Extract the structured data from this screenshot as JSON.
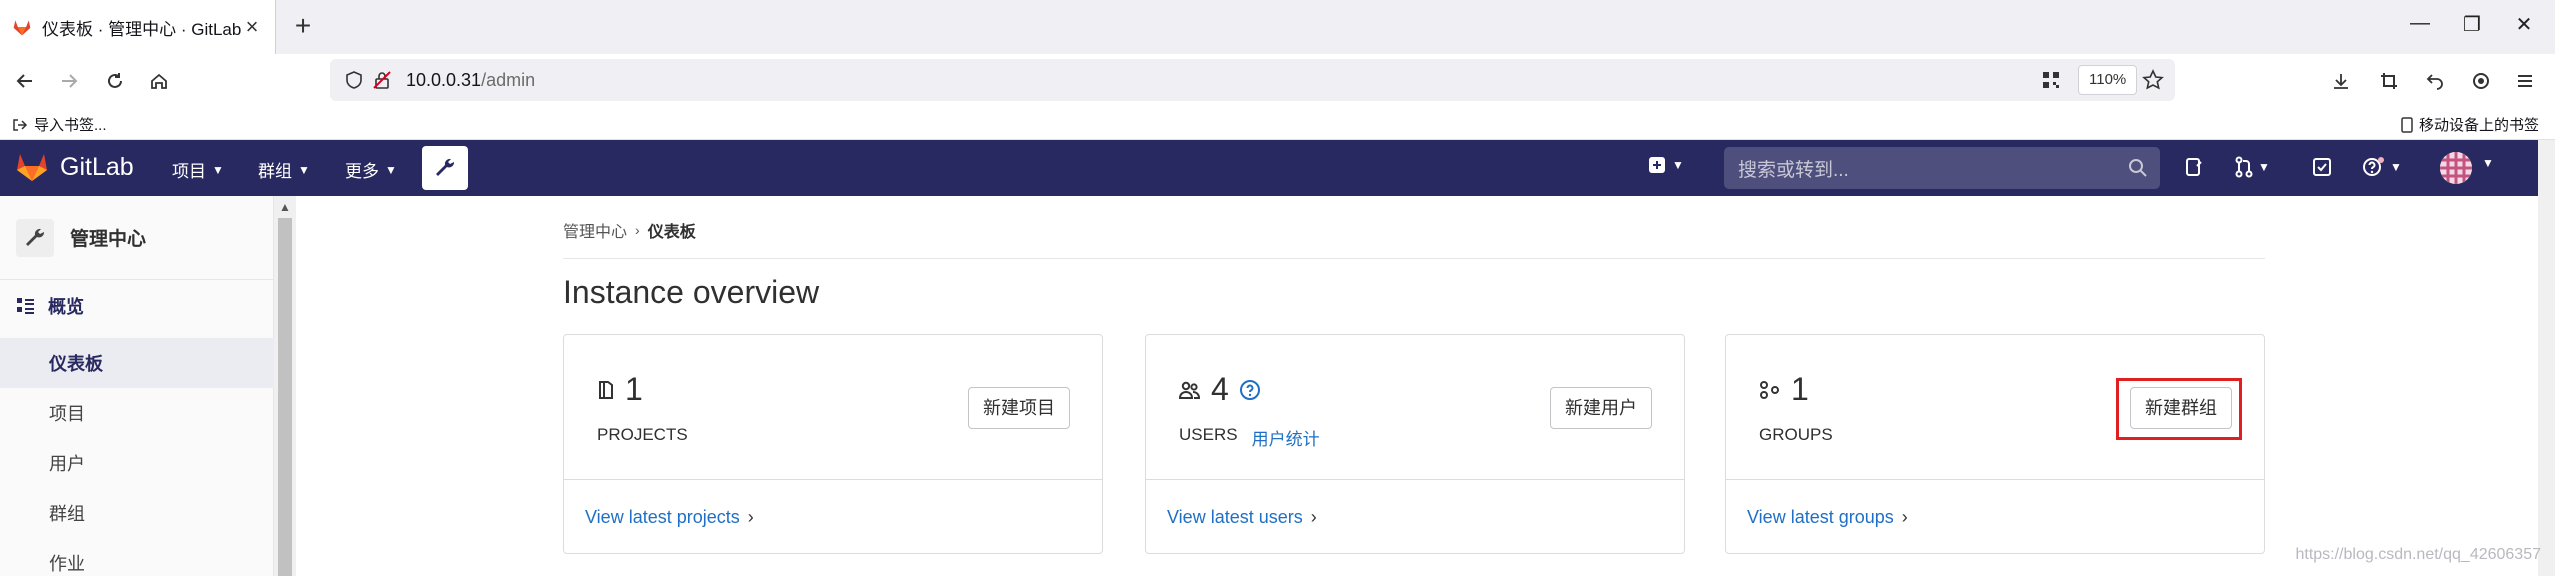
{
  "browser": {
    "tab_title": "仪表板 · 管理中心 · GitLab",
    "url_host": "10.0.0.31",
    "url_path": "/admin",
    "zoom": "110%",
    "bookmark_import": "导入书签...",
    "bookmark_mobile": "移动设备上的书签"
  },
  "gitlab": {
    "brand": "GitLab",
    "menu": [
      {
        "label": "项目"
      },
      {
        "label": "群组"
      },
      {
        "label": "更多"
      }
    ],
    "search_placeholder": "搜索或转到..."
  },
  "sidebar": {
    "title": "管理中心",
    "section": "概览",
    "items": [
      {
        "label": "仪表板",
        "active": true
      },
      {
        "label": "项目"
      },
      {
        "label": "用户"
      },
      {
        "label": "群组"
      },
      {
        "label": "作业"
      }
    ]
  },
  "main": {
    "breadcrumb": [
      "管理中心",
      "仪表板"
    ],
    "title": "Instance overview",
    "cards": [
      {
        "count": "1",
        "label": "PROJECTS",
        "button": "新建项目",
        "footer": "View latest projects"
      },
      {
        "count": "4",
        "label": "USERS",
        "extra_link": "用户统计",
        "button": "新建用户",
        "footer": "View latest users"
      },
      {
        "count": "1",
        "label": "GROUPS",
        "button": "新建群组",
        "footer": "View latest groups"
      }
    ]
  },
  "watermark": "https://blog.csdn.net/qq_42606357",
  "colors": {
    "header_bg": "#292961",
    "link": "#1f6fc5",
    "highlight": "#e02020"
  }
}
